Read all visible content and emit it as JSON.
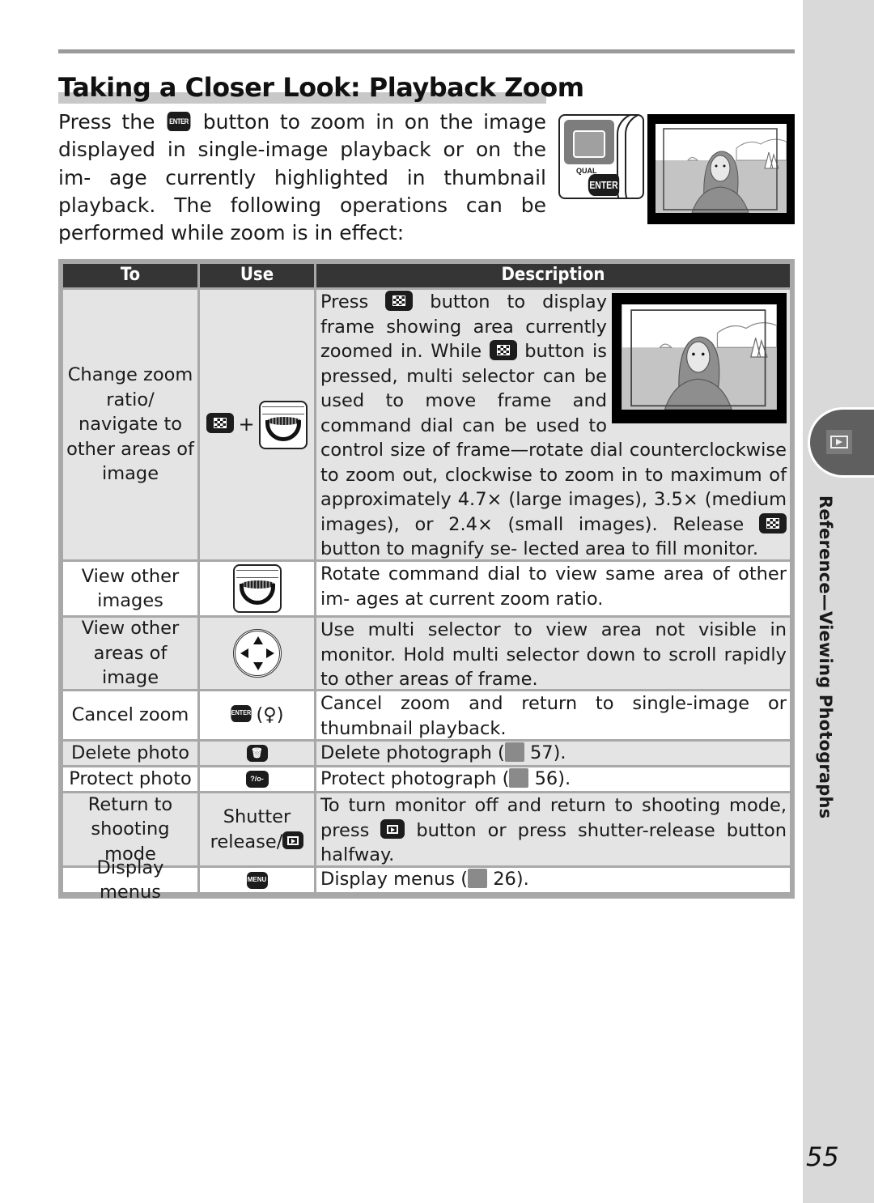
{
  "header": {
    "title": "Taking a Closer Look: Playback Zoom"
  },
  "intro": {
    "part1": "Press the",
    "enter_icon": "ENTER",
    "part2": "button to zoom in on the image displayed in single-image playback or on the im- age currently highlighted in thumbnail playback. The following operations can be performed while zoom is in effect:"
  },
  "camera_illustration": {
    "qual_label": "QUAL",
    "enter_label": "ENTER"
  },
  "table": {
    "headers": [
      "To",
      "Use",
      "Description"
    ],
    "rows": [
      {
        "to": "Change zoom ratio/ navigate to other areas of image",
        "use_icons": [
          "thumbnail-button-icon",
          "plus",
          "command-dial-icon"
        ],
        "use_plus": "+",
        "desc_parts": [
          "Press",
          "button to display frame showing area currently zoomed in.  While",
          "button is pressed, multi selector can be used to move frame and command dial can be used to control size of frame—rotate dial counterclockwise to zoom out, clockwise to zoom in to maximum of approximately 4.7× (large images), 3.5× (medium images), or 2.4× (small images).  Release",
          "button to magnify se- lected area to fill monitor."
        ]
      },
      {
        "to": "View other images",
        "use_icons": [
          "command-dial-icon"
        ],
        "desc": "Rotate command dial to view same area of other im- ages at current zoom ratio."
      },
      {
        "to": "View other areas of image",
        "use_icons": [
          "multi-selector-icon"
        ],
        "desc": "Use multi selector to view area not visible in monitor. Hold multi selector down to scroll rapidly to other areas of frame."
      },
      {
        "to": "Cancel zoom",
        "use_icons": [
          "enter-button-icon"
        ],
        "use_icon_label": "ENTER",
        "use_suffix": "(♀)",
        "desc": "Cancel zoom and return to single-image or thumbnail playback."
      },
      {
        "to": "Delete photo",
        "use_icons": [
          "trash-button-icon"
        ],
        "use_icon_label": "🗑",
        "desc_before": "Delete photograph (",
        "desc_page": "57",
        "desc_after": ")."
      },
      {
        "to": "Protect photo",
        "use_icons": [
          "protect-button-icon"
        ],
        "use_icon_label": "?/o-",
        "desc_before": "Protect photograph (",
        "desc_page": "56",
        "desc_after": ")."
      },
      {
        "to": "Return to shooting mode",
        "use_text": "Shutter release/",
        "use_icons": [
          "playback-button-icon"
        ],
        "desc_parts": [
          "To turn monitor off and return to shooting mode, press",
          "button or press shutter-release button halfway."
        ]
      },
      {
        "to": "Display menus",
        "use_icons": [
          "menu-button-icon"
        ],
        "use_icon_label": "MENU",
        "desc_before": "Display menus (",
        "desc_page": "26",
        "desc_after": ")."
      }
    ]
  },
  "sidebar": {
    "section_label": "Reference—Viewing Photographs",
    "tab_icon": "playback-icon"
  },
  "footer": {
    "page_number": "55"
  }
}
